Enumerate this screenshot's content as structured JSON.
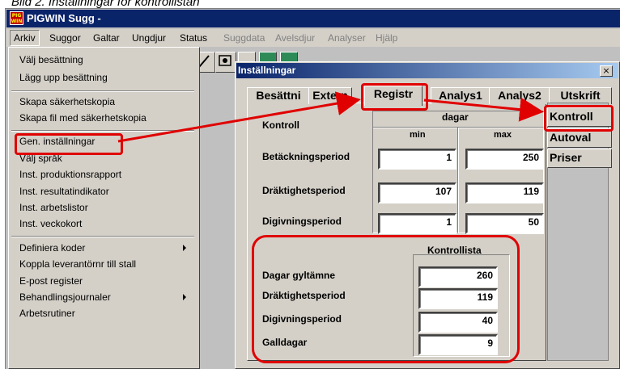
{
  "caption": "Bild 2. Inställningar för kontrollistan",
  "app": {
    "title": "PIGWIN Sugg -",
    "logo_text": "PIG WIN"
  },
  "menubar": {
    "items": [
      {
        "label": "Arkiv",
        "enabled": true
      },
      {
        "label": "Suggor",
        "enabled": true
      },
      {
        "label": "Galtar",
        "enabled": true
      },
      {
        "label": "Ungdjur",
        "enabled": true
      },
      {
        "label": "Status",
        "enabled": true
      },
      {
        "label": "Suggdata",
        "enabled": false
      },
      {
        "label": "Avelsdjur",
        "enabled": false
      },
      {
        "label": "Analyser",
        "enabled": false
      },
      {
        "label": "Hjälp",
        "enabled": false
      }
    ]
  },
  "arkiv_menu": {
    "items": [
      "Välj besättning",
      "Lägg upp besättning",
      "Skapa säkerhetskopia",
      "Skapa fil med säkerhetskopia",
      "Gen. inställningar",
      "Välj språk",
      "Inst. produktionsrapport",
      "Inst. resultatindikator",
      "Inst. arbetslistor",
      "Inst. veckokort",
      "Definiera koder",
      "Koppla leverantörnr till stall",
      "E-post register",
      "Behandlingsjournaler",
      "Arbetsrutiner"
    ]
  },
  "dialog": {
    "title": "Inställningar",
    "close": "×",
    "tabs": [
      "Besättni",
      "Extern",
      "Registr",
      "Analys1",
      "Analys2",
      "Utskrift"
    ],
    "side_tabs": [
      "Kontroll",
      "Autoval",
      "Priser"
    ],
    "kontroll": {
      "title": "Kontroll",
      "dagar": "dagar",
      "min": "min",
      "max": "max",
      "rows": [
        {
          "label": "Betäckningsperiod",
          "min": "1",
          "max": "250"
        },
        {
          "label": "Dräktighetsperiod",
          "min": "107",
          "max": "119"
        },
        {
          "label": "Digivningsperiod",
          "min": "1",
          "max": "50"
        }
      ]
    },
    "kontrollista": {
      "title": "Kontrollista",
      "rows": [
        {
          "label": "Dagar gyltämne",
          "value": "260"
        },
        {
          "label": "Dräktighetsperiod",
          "value": "119"
        },
        {
          "label": "Digivningsperiod",
          "value": "40"
        },
        {
          "label": "Galldagar",
          "value": "9"
        }
      ]
    }
  },
  "colors": {
    "annotation": "#e00000",
    "titlebar": "#0a246a",
    "face": "#d4d0c8"
  }
}
